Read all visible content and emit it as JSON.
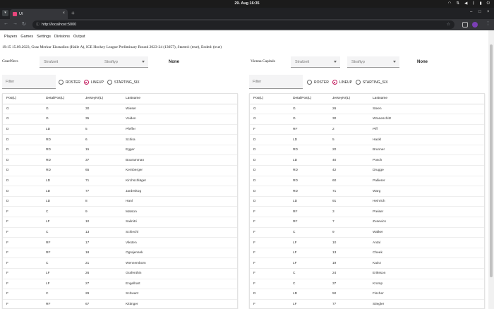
{
  "os": {
    "clock": "29. Aug 16:35"
  },
  "browser": {
    "tab_title": "UI",
    "url": "http://localhost:5000"
  },
  "nav": [
    "Players",
    "Games",
    "Settings",
    "Divisions",
    "Output"
  ],
  "match_info": "19:15 15.09.2023, Graz Merkur Eisstadion (Halle A), ICE Hockey League Preliminary Round 2023-24 (13057), Started: (true), Ended: (true)",
  "controls": {
    "penalty_time_placeholder": "Strafzeit",
    "penalty_type_placeholder": "Straftyp",
    "none_label": "None",
    "filter_placeholder": "Filter",
    "radio_options": [
      "ROSTER",
      "LINEUP",
      "STARTING_SIX"
    ],
    "selected_radio": "LINEUP"
  },
  "table_headers": [
    "Pos(L)",
    "DetailPos(L)",
    "JerseyNr(L)",
    "Lastname"
  ],
  "teams": [
    {
      "name": "Graz99ers",
      "rows": [
        [
          "G",
          "G",
          "30",
          "Wieser"
        ],
        [
          "G",
          "G",
          "35",
          "Voiden"
        ],
        [
          "D",
          "LD",
          "5",
          "Pfeffer"
        ],
        [
          "D",
          "RD",
          "6",
          "Schira"
        ],
        [
          "D",
          "RD",
          "15",
          "Egger"
        ],
        [
          "D",
          "RD",
          "37",
          "Bouramman"
        ],
        [
          "D",
          "RD",
          "65",
          "Kernberger"
        ],
        [
          "D",
          "LD",
          "71",
          "Kirchschläger"
        ],
        [
          "D",
          "LD",
          "77",
          "Jardeskog"
        ],
        [
          "D",
          "LD",
          "8",
          "Hanl"
        ],
        [
          "F",
          "C",
          "9",
          "Matson"
        ],
        [
          "F",
          "LF",
          "10",
          "Salinitri"
        ],
        [
          "F",
          "C",
          "13",
          "Schiechl"
        ],
        [
          "F",
          "RF",
          "17",
          "Viksten"
        ],
        [
          "F",
          "RF",
          "18",
          "Ograjensek"
        ],
        [
          "F",
          "C",
          "21",
          "Wennemborn"
        ],
        [
          "F",
          "LF",
          "26",
          "Grafenthin"
        ],
        [
          "F",
          "LF",
          "27",
          "Engelhart"
        ],
        [
          "F",
          "C",
          "29",
          "Schwarz"
        ],
        [
          "F",
          "RF",
          "67",
          "Kittinger"
        ]
      ]
    },
    {
      "name": "Vienna Capitals",
      "rows": [
        [
          "G",
          "G",
          "26",
          "Steen"
        ],
        [
          "G",
          "G",
          "30",
          "Wraneschitz"
        ],
        [
          "F",
          "RF",
          "2",
          "Piff"
        ],
        [
          "D",
          "LD",
          "5",
          "Hackl"
        ],
        [
          "D",
          "RD",
          "20",
          "Brunner"
        ],
        [
          "D",
          "LD",
          "40",
          "Posch"
        ],
        [
          "D",
          "RD",
          "42",
          "Drugge"
        ],
        [
          "D",
          "RD",
          "60",
          "Pallierer"
        ],
        [
          "D",
          "RD",
          "71",
          "Warg"
        ],
        [
          "D",
          "LD",
          "91",
          "Heinrich"
        ],
        [
          "F",
          "RF",
          "3",
          "Preiser"
        ],
        [
          "F",
          "RF",
          "7",
          "Zusevics"
        ],
        [
          "F",
          "C",
          "9",
          "Walker"
        ],
        [
          "F",
          "LF",
          "10",
          "Antal"
        ],
        [
          "F",
          "LF",
          "13",
          "Cheek"
        ],
        [
          "F",
          "LF",
          "19",
          "Kainz"
        ],
        [
          "F",
          "C",
          "24",
          "Eriksson"
        ],
        [
          "F",
          "C",
          "37",
          "Kromp"
        ],
        [
          "D",
          "LD",
          "50",
          "Fischer"
        ],
        [
          "F",
          "LF",
          "77",
          "Stiegler"
        ]
      ]
    }
  ]
}
